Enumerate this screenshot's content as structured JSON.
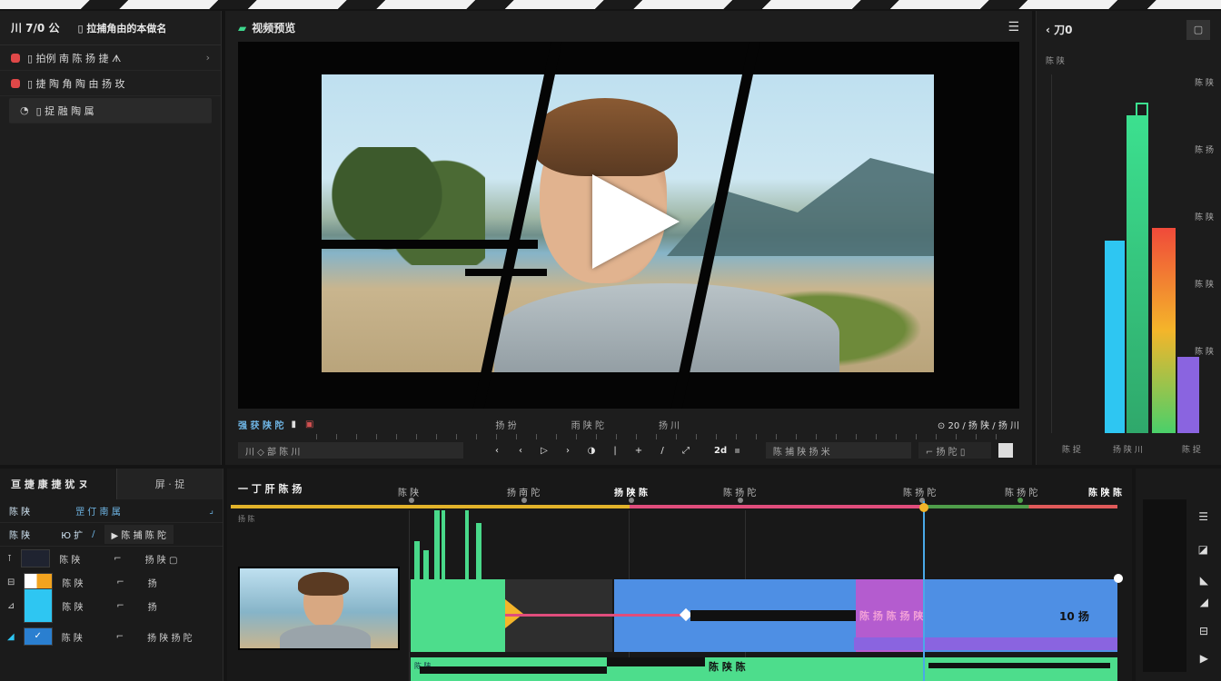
{
  "left_panel": {
    "header_left": "川 7/0 公",
    "header_right": "▯ 拉捕角由的本做名",
    "items": [
      {
        "label": "▯ 拍例 南 陈 扬 捷 ᗑ",
        "color": "#e04848",
        "chevron": "›"
      },
      {
        "label": "▯ 捷 陶 角 陶 由 扬 玫",
        "color": "#e04848",
        "chevron": ""
      },
      {
        "label": "▯ 捉 融 陶 属",
        "color": "#cccccc",
        "chevron": ""
      }
    ]
  },
  "preview": {
    "title": "视频预览",
    "menu_icon": "☰",
    "info_left": "强 获 陕 陀",
    "info_mid1": "扬 扮",
    "info_mid2": "雨 陕 陀",
    "info_mid3": "扬 川",
    "info_right": "⊙ 20 / 扬 陕 / 扬 川",
    "field_left": "川 ◇ 部 陈 川",
    "field_right": "陈 捕 陕 扬 米",
    "field_right2": "⌐ 扬 陀 ▯",
    "timecode": "2d"
  },
  "scopes": {
    "title": "‹ 刀0",
    "button": "▢",
    "axis_top": "陈 陕",
    "right_labels": [
      "陈 陕",
      "陈 扬",
      "陈 陕",
      "陈 陕",
      "陈 陕"
    ],
    "footer": [
      "陈 捉",
      "扬 陕 川",
      "陈 捉"
    ]
  },
  "timeline_left": {
    "tab_active": "亘 捷 康 捷 犹 ヌ",
    "tab_inactive": "屏 · 捉",
    "row1_left": "陈 陕",
    "row1_right": "罡 仃 南 属",
    "row2_left": "陈 陕",
    "row2_mid": "Ю 扩",
    "row2_btn": "▶ 陈 捕 陈 陀",
    "tracks": [
      {
        "icon": "⊺",
        "label": "陈 陕",
        "mark": "⌐",
        "value": "扬 陕 ▢"
      },
      {
        "icon": "⊟",
        "label": "陈 陕",
        "mark": "⌐",
        "value": "扬"
      },
      {
        "icon": "⊿",
        "label": "陈 陕",
        "mark": "⌐",
        "value": "扬"
      },
      {
        "icon": "◢",
        "label": "陈 陕",
        "mark": "⌐",
        "value": "扬 陕 扬 陀"
      }
    ]
  },
  "timeline": {
    "title": "一 丁 肝 陈 扬",
    "sub": "扬 陈",
    "markers": [
      {
        "label": "陈 陕",
        "strong": false
      },
      {
        "label": "扬 南 陀",
        "strong": false
      },
      {
        "label": "扬 陕 陈",
        "strong": true
      },
      {
        "label": "陈 扬 陀",
        "strong": false
      },
      {
        "label": "陈 扬 陀",
        "strong": false
      },
      {
        "label": "陈 扬 陀",
        "strong": false
      },
      {
        "label": "陈 陕 陈",
        "strong": true
      }
    ],
    "clip_label1": "陈 扬 陈 扬 陕",
    "clip_label2": "10 扬",
    "clip_label3": "陈 陕 陈",
    "clip_small": "陈 陕"
  }
}
